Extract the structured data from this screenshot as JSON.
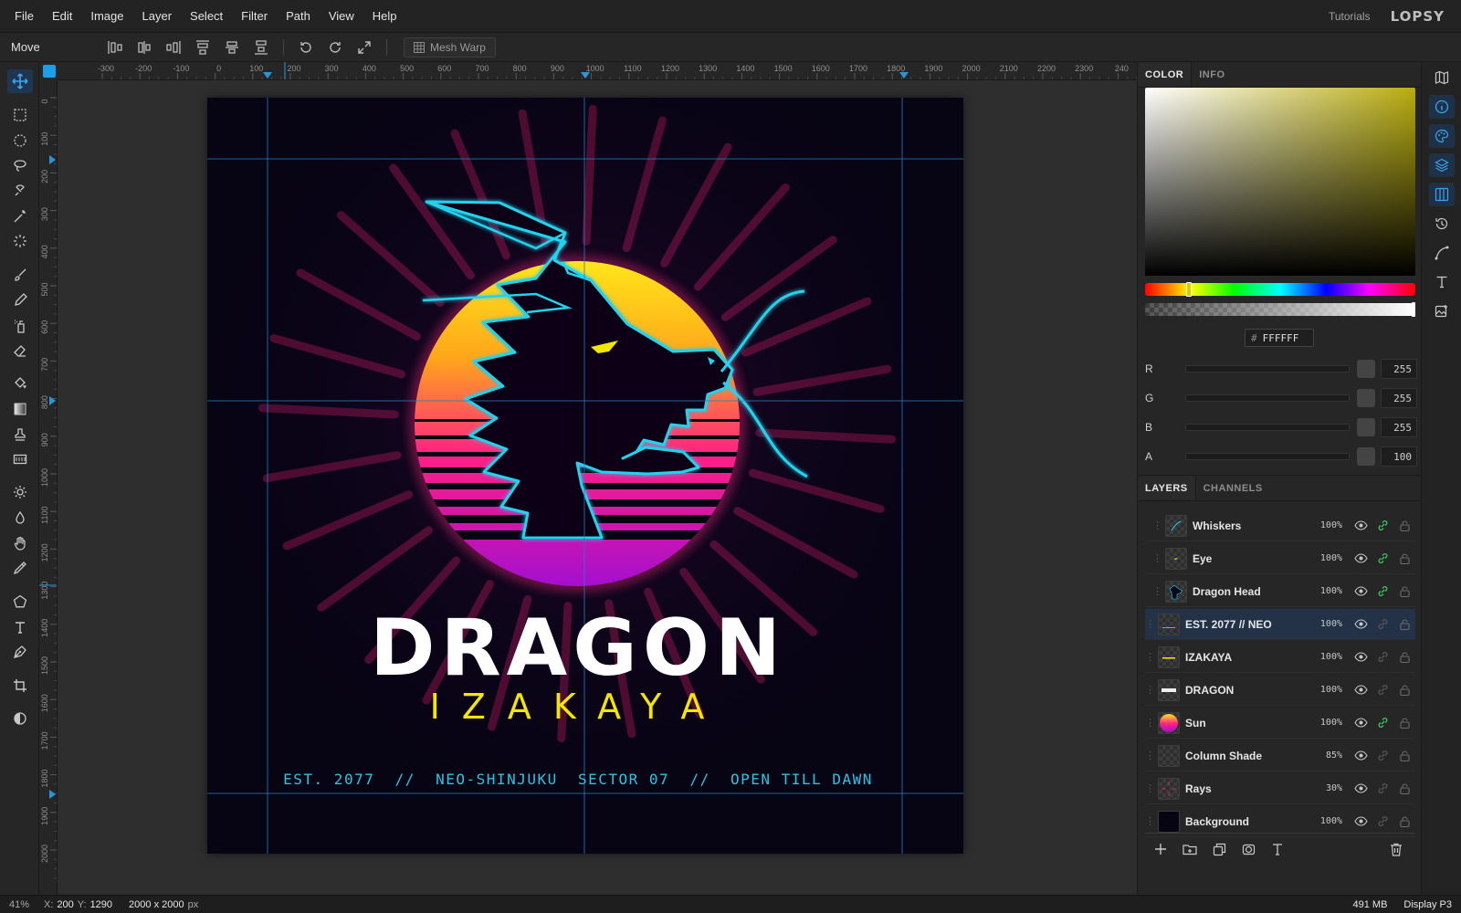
{
  "menu": {
    "items": [
      "File",
      "Edit",
      "Image",
      "Layer",
      "Select",
      "Filter",
      "Path",
      "View",
      "Help"
    ],
    "tutorials": "Tutorials",
    "logo": "LOPSY"
  },
  "options": {
    "tool_name": "Move",
    "mesh_warp": "Mesh Warp"
  },
  "ruler": {
    "h_labels": [
      "-300",
      "-200",
      "-100",
      "0",
      "100",
      "200",
      "300",
      "400",
      "500",
      "600",
      "700",
      "800",
      "900",
      "1000",
      "1100",
      "1200",
      "1300",
      "1400",
      "1500",
      "1600",
      "1700",
      "1800",
      "1900",
      "2000",
      "2100",
      "2200",
      "2300",
      "240"
    ],
    "v_labels": [
      "0",
      "100",
      "200",
      "300",
      "400",
      "500",
      "600",
      "700",
      "800",
      "900",
      "1000",
      "1100",
      "1200",
      "1300",
      "1400",
      "1500",
      "1600",
      "1700",
      "1800",
      "1900",
      "2000"
    ]
  },
  "artwork": {
    "title": "DRAGON",
    "subtitle": "IZAKAYA",
    "tagline": "EST. 2077  //  NEO-SHINJUKU  SECTOR 07  //  OPEN TILL DAWN",
    "colors": {
      "background": "#070414",
      "neon_cyan": "#22d3ee",
      "title": "#ffffff",
      "subtitle": "#f5e600",
      "tagline": "#27c6e6",
      "sun_top": "#ffe11a",
      "sun_bottom": "#c010c0"
    }
  },
  "color_panel": {
    "tabs": [
      "COLOR",
      "INFO"
    ],
    "hex_hash": "#",
    "hex": "FFFFFF",
    "channels": [
      {
        "label": "R",
        "value": "255"
      },
      {
        "label": "G",
        "value": "255"
      },
      {
        "label": "B",
        "value": "255"
      },
      {
        "label": "A",
        "value": "100"
      }
    ]
  },
  "layers_panel": {
    "tabs": [
      "LAYERS",
      "CHANNELS"
    ],
    "layers": [
      {
        "name": "Whiskers",
        "opacity": "100%",
        "linked": true,
        "indent": true
      },
      {
        "name": "Eye",
        "opacity": "100%",
        "linked": true,
        "indent": true
      },
      {
        "name": "Dragon Head",
        "opacity": "100%",
        "linked": true,
        "indent": true
      },
      {
        "name": "EST. 2077 // NEO",
        "opacity": "100%",
        "linked": false,
        "selected": true
      },
      {
        "name": "IZAKAYA",
        "opacity": "100%",
        "linked": false
      },
      {
        "name": "DRAGON",
        "opacity": "100%",
        "linked": false
      },
      {
        "name": "Sun",
        "opacity": "100%",
        "linked": true
      },
      {
        "name": "Column Shade",
        "opacity": "85%",
        "linked": false
      },
      {
        "name": "Rays",
        "opacity": "30%",
        "linked": false
      },
      {
        "name": "Background",
        "opacity": "100%",
        "linked": false
      }
    ]
  },
  "status": {
    "zoom": "41%",
    "x_label": "X:",
    "x": "200",
    "y_label": "Y:",
    "y": "1290",
    "doc_size": "2000 x 2000",
    "doc_unit": "px",
    "memory": "491 MB",
    "color_profile": "Display P3"
  },
  "accent": "#1aa0e8"
}
